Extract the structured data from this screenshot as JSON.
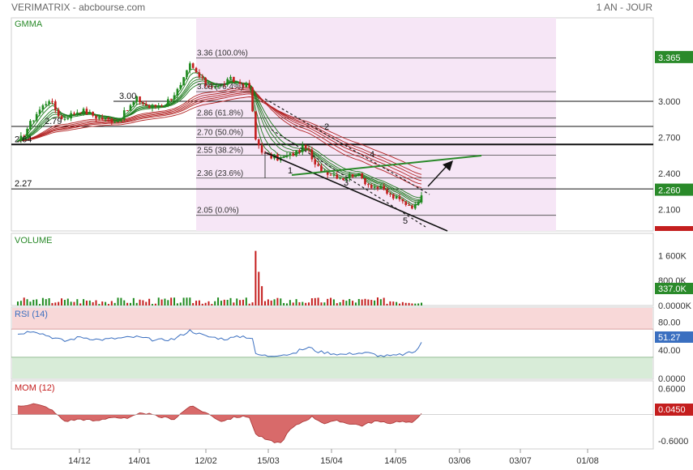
{
  "header": {
    "title": "VERIMATRIX - abcbourse.com",
    "period": "1 AN - JOUR"
  },
  "colors": {
    "up": "#1e8a1e",
    "down": "#c41e1e",
    "accent_green": "#2a8a2a",
    "rsi_line": "#3a6fc0",
    "fib_fill": "#f6e6f6",
    "mom_fill": "#d86a6a",
    "rsi_over": "#f8d8d8",
    "rsi_under": "#d8ecd8"
  },
  "chart_data": [
    {
      "type": "candlestick",
      "panel": "GMMA",
      "title": "GMMA",
      "ylim": [
        1.96,
        3.56
      ],
      "y_ticks": [
        "3.365",
        "3.000",
        "2.700",
        "2.400",
        "2.100"
      ],
      "x_ticks": [
        "14/12",
        "14/01",
        "12/02",
        "15/03",
        "15/04",
        "14/05",
        "03/06",
        "03/07",
        "01/08"
      ],
      "last_price_label": "3.365",
      "current_price_label": "2.260",
      "levels": [
        {
          "label": "3.00",
          "value": 3.0
        },
        {
          "label": "2.79",
          "value": 2.79
        },
        {
          "label": "2.64",
          "value": 2.64
        },
        {
          "label": "2.27",
          "value": 2.27
        }
      ],
      "fibonacci": [
        {
          "label": "3.36 (100.0%)",
          "value": 3.36
        },
        {
          "label": "3.08 (76.4%)",
          "value": 3.08
        },
        {
          "label": "2.86 (61.8%)",
          "value": 2.86
        },
        {
          "label": "2.70 (50.0%)",
          "value": 2.7
        },
        {
          "label": "2.55 (38.2%)",
          "value": 2.55
        },
        {
          "label": "2.36 (23.6%)",
          "value": 2.36
        },
        {
          "label": "2.05 (0.0%)",
          "value": 2.05
        }
      ],
      "wave_labels": [
        "1",
        "2",
        "3",
        "4",
        "5"
      ],
      "close_anchors": [
        [
          0,
          2.65
        ],
        [
          6,
          2.9
        ],
        [
          10,
          3.02
        ],
        [
          14,
          2.85
        ],
        [
          20,
          2.93
        ],
        [
          26,
          2.86
        ],
        [
          32,
          2.84
        ],
        [
          38,
          3.02
        ],
        [
          42,
          2.95
        ],
        [
          47,
          2.98
        ],
        [
          52,
          3.12
        ],
        [
          55,
          3.3
        ],
        [
          60,
          3.14
        ],
        [
          64,
          3.12
        ],
        [
          68,
          3.18
        ],
        [
          74,
          3.12
        ],
        [
          76,
          2.68
        ],
        [
          79,
          2.55
        ],
        [
          84,
          2.52
        ],
        [
          88,
          2.56
        ],
        [
          92,
          2.63
        ],
        [
          95,
          2.46
        ],
        [
          100,
          2.4
        ],
        [
          104,
          2.36
        ],
        [
          108,
          2.4
        ],
        [
          112,
          2.31
        ],
        [
          116,
          2.27
        ],
        [
          120,
          2.2
        ],
        [
          124,
          2.15
        ],
        [
          127,
          2.12
        ],
        [
          129,
          2.24
        ]
      ]
    },
    {
      "type": "bar",
      "panel": "VOLUME",
      "title": "VOLUME",
      "ylim": [
        0,
        2000
      ],
      "y_ticks": [
        "1 600K",
        "800.0K",
        "0.0000K"
      ],
      "current_label": "337.0K",
      "spikes": [
        {
          "index": 76,
          "value": 1750
        },
        {
          "index": 77,
          "value": 1080
        },
        {
          "index": 78,
          "value": 620
        }
      ]
    },
    {
      "type": "line",
      "panel": "RSI",
      "title": "RSI (14)",
      "ylim": [
        0,
        100
      ],
      "y_ticks": [
        "80.00",
        "40.00",
        "0.0000"
      ],
      "current_label": "51.27",
      "overbought": 70,
      "oversold": 30,
      "anchors": [
        [
          0,
          63
        ],
        [
          5,
          68
        ],
        [
          10,
          60
        ],
        [
          15,
          53
        ],
        [
          20,
          59
        ],
        [
          26,
          55
        ],
        [
          32,
          57
        ],
        [
          38,
          59
        ],
        [
          44,
          54
        ],
        [
          50,
          56
        ],
        [
          55,
          68
        ],
        [
          60,
          60
        ],
        [
          66,
          56
        ],
        [
          72,
          60
        ],
        [
          75,
          57
        ],
        [
          76,
          34
        ],
        [
          80,
          32
        ],
        [
          84,
          34
        ],
        [
          88,
          34
        ],
        [
          90,
          40
        ],
        [
          93,
          44
        ],
        [
          96,
          38
        ],
        [
          100,
          36
        ],
        [
          104,
          34
        ],
        [
          108,
          36
        ],
        [
          112,
          36
        ],
        [
          116,
          32
        ],
        [
          120,
          32
        ],
        [
          124,
          35
        ],
        [
          127,
          38
        ],
        [
          129,
          50
        ]
      ]
    },
    {
      "type": "area",
      "panel": "MOM",
      "title": "MOM (12)",
      "ylim": [
        -0.75,
        0.7
      ],
      "y_ticks": [
        "0.6000",
        "-0.6000"
      ],
      "current_label": "0.0450",
      "anchors": [
        [
          0,
          0.2
        ],
        [
          5,
          0.25
        ],
        [
          10,
          0.15
        ],
        [
          15,
          -0.15
        ],
        [
          20,
          -0.1
        ],
        [
          25,
          -0.15
        ],
        [
          30,
          -0.05
        ],
        [
          35,
          -0.1
        ],
        [
          40,
          0.05
        ],
        [
          45,
          -0.05
        ],
        [
          50,
          -0.1
        ],
        [
          55,
          0.2
        ],
        [
          60,
          0.05
        ],
        [
          65,
          -0.15
        ],
        [
          70,
          -0.05
        ],
        [
          74,
          -0.05
        ],
        [
          76,
          -0.45
        ],
        [
          80,
          -0.6
        ],
        [
          84,
          -0.65
        ],
        [
          87,
          -0.35
        ],
        [
          90,
          -0.2
        ],
        [
          94,
          -0.05
        ],
        [
          98,
          -0.2
        ],
        [
          102,
          -0.15
        ],
        [
          106,
          -0.2
        ],
        [
          110,
          -0.25
        ],
        [
          114,
          -0.15
        ],
        [
          118,
          -0.2
        ],
        [
          122,
          -0.15
        ],
        [
          126,
          -0.2
        ],
        [
          129,
          0.05
        ]
      ]
    }
  ]
}
